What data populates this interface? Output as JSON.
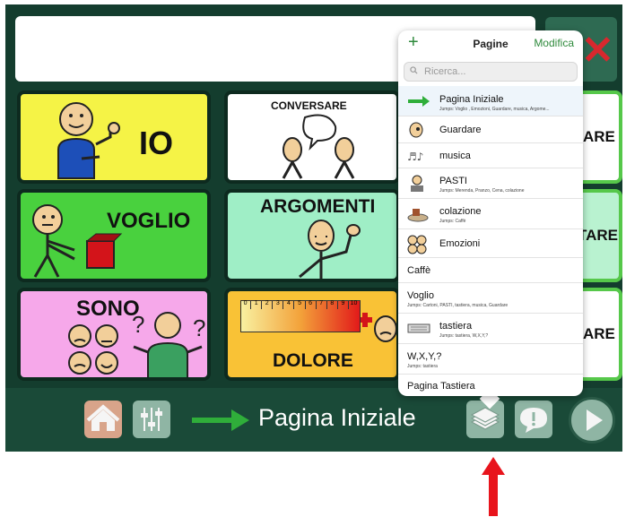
{
  "tiles": {
    "io": "IO",
    "voglio": "VOGLIO",
    "sono": "SONO",
    "conversare": "CONVERSARE",
    "argomenti": "ARGOMENTI",
    "dolore": "DOLORE",
    "right1": "ARE",
    "right2": "TARE",
    "right3": "ARE",
    "pain_scale": [
      "0",
      "1",
      "2",
      "3",
      "4",
      "5",
      "6",
      "7",
      "8",
      "9",
      "10"
    ]
  },
  "bottom": {
    "current_page": "Pagina Iniziale"
  },
  "popover": {
    "add": "+",
    "title": "Pagine",
    "edit": "Modifica",
    "search_placeholder": "Ricerca...",
    "items": [
      {
        "label": "Pagina Iniziale",
        "sub": "Jumps: Voglio , Emozioni, Guardare, musica, Argome...",
        "icon": "green-arrow-icon"
      },
      {
        "label": "Guardare",
        "sub": "",
        "icon": "eye-icon"
      },
      {
        "label": "musica",
        "sub": "",
        "icon": "music-notes-icon"
      },
      {
        "label": "PASTI",
        "sub": "Jumps: Merenda, Pranzo, Cena, colazione",
        "icon": "meal-icon"
      },
      {
        "label": "colazione",
        "sub": "Jumps: Caffè",
        "icon": "breakfast-icon"
      },
      {
        "label": "Emozioni",
        "sub": "",
        "icon": "emotions-icon"
      },
      {
        "label": "Caffè",
        "sub": "",
        "icon": ""
      },
      {
        "label": "Voglio",
        "sub": "Jumps: Cartoni, PASTI, tastiera, musica, Guardare",
        "icon": ""
      },
      {
        "label": "tastiera",
        "sub": "Jumps: tastiera, W,X,Y,?",
        "icon": "keyboard-icon"
      },
      {
        "label": "W,X,Y,?",
        "sub": "Jumps: tastiera",
        "icon": ""
      },
      {
        "label": "Pagina Tastiera",
        "sub": "",
        "icon": ""
      }
    ]
  },
  "colors": {
    "app_bg": "#143d2e",
    "accent_green": "#2f8a3c",
    "red_marker": "#e8141c"
  }
}
